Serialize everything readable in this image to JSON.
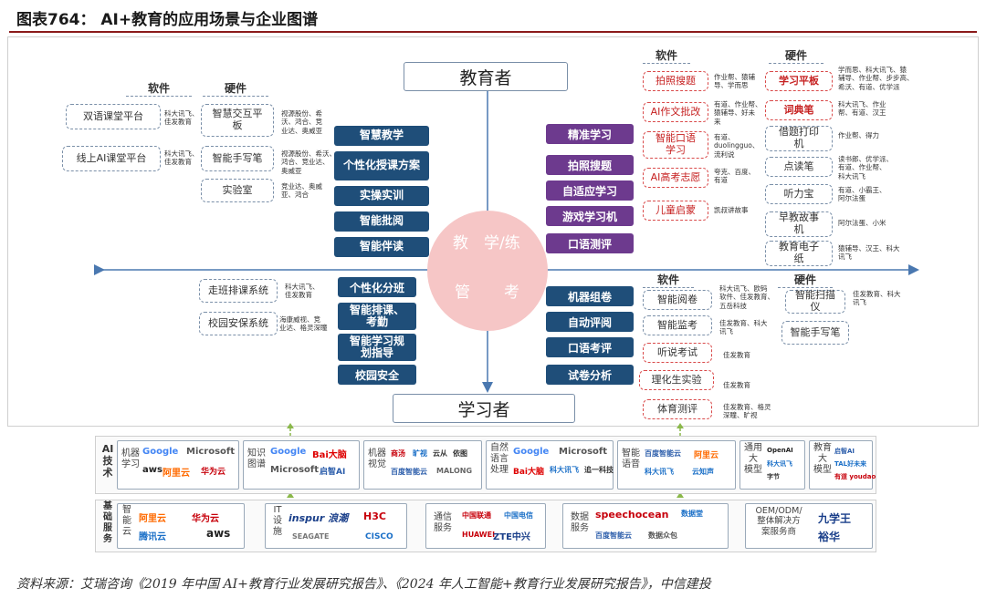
{
  "title": "图表764： AI+教育的应用场景与企业图谱",
  "source": "资料来源：艾瑞咨询《2019 年中国 AI+教育行业发展研究报告》、《2024 年人工智能+教育行业发展研究报告》，中信建投",
  "roles": {
    "educator": "教育者",
    "learner": "学习者"
  },
  "center": {
    "teach": "教",
    "learn": "学/练",
    "manage": "管",
    "test": "考"
  },
  "headers": {
    "software": "软件",
    "hardware": "硬件"
  },
  "top_left": {
    "software": [
      {
        "label": "双语课堂平台",
        "companies": "科大讯飞、\n佳发教育"
      },
      {
        "label": "线上AI课堂平台",
        "companies": "科大讯飞、\n佳发教育"
      }
    ],
    "hardware": [
      {
        "label": "智慧交互平板",
        "companies": "视源股份、希\n沃、鸿合、竞\n业达、奥威亚"
      },
      {
        "label": "智能手写笔",
        "companies": "视源股份、希沃、\n鸿合、竞业达、\n奥威亚"
      },
      {
        "label": "实验室",
        "companies": "竞业达、奥威\n亚、鸿合"
      }
    ]
  },
  "teach_items": [
    "智慧教学",
    "个性化授课方案",
    "实操实训",
    "智能批阅",
    "智能伴读"
  ],
  "learn_items": [
    "精准学习",
    "拍照搜题",
    "自适应学习",
    "游戏学习机",
    "口语测评"
  ],
  "manage_items": [
    "个性化分班",
    "智能排课、考勤",
    "智能学习规划指导",
    "校园安全"
  ],
  "test_items": [
    "机器组卷",
    "自动评阅",
    "口语考评",
    "试卷分析"
  ],
  "top_right": {
    "software": [
      {
        "label": "拍照搜题",
        "companies": "作业帮、猿辅\n导、学而思"
      },
      {
        "label": "AI作文批改",
        "companies": "有道、作业帮、\n猿辅导、好未\n来"
      },
      {
        "label": "智能口语学习",
        "companies": "有道、\nduolingguo、\n流利说"
      },
      {
        "label": "AI高考志愿",
        "companies": "夸克、百度、\n有道"
      },
      {
        "label": "儿童启蒙",
        "companies": "凯叔讲故事"
      }
    ],
    "hardware": [
      {
        "label": "学习平板",
        "companies": "学而思、科大讯飞、猿\n辅导、作业帮、步步高、\n希沃、有道、优学派"
      },
      {
        "label": "词典笔",
        "companies": "科大讯飞、作业\n帮、有道、汉王"
      },
      {
        "label": "借题打印机",
        "companies": "作业帮、得力"
      },
      {
        "label": "点读笔",
        "companies": "读书郎、优学派、\n有道、作业帮、\n科大讯飞"
      },
      {
        "label": "听力宝",
        "companies": "有道、小霸王、\n阿尔法蛋"
      },
      {
        "label": "早教故事机",
        "companies": "阿尔法蛋、小米"
      },
      {
        "label": "教育电子纸",
        "companies": "猿辅导、汉王、科大\n讯飞"
      }
    ]
  },
  "bottom_left": [
    {
      "label": "走班排课系统",
      "companies": "科大讯飞、\n佳发教育"
    },
    {
      "label": "校园安保系统",
      "companies": "海康威视、竞\n业达、格灵深瞳"
    }
  ],
  "bottom_right": {
    "software": [
      {
        "label": "智能阅卷",
        "companies": "科大讯飞、欧码\n软件、佳发教育、\n五岳科技"
      },
      {
        "label": "智能监考",
        "companies": "佳发教育、科大\n讯飞"
      },
      {
        "label": "听说考试",
        "companies": "佳发教育"
      },
      {
        "label": "理化生实验",
        "companies": "佳发教育"
      },
      {
        "label": "体育测评",
        "companies": "佳发教育、格灵\n深瞳、旷视"
      }
    ],
    "hardware": [
      {
        "label": "智能扫描仪",
        "companies": "佳发教育、科大\n讯飞"
      },
      {
        "label": "智能手写笔",
        "companies": ""
      }
    ]
  },
  "ai_tech": {
    "label": "AI\n技\n术",
    "cells": [
      {
        "name": "机器\n学习",
        "logos": [
          "Google",
          "Microsoft",
          "aws",
          "阿里云",
          "华为云"
        ]
      },
      {
        "name": "知识\n图谱",
        "logos": [
          "Google",
          "Bai大脑",
          "Microsoft",
          "启智AI"
        ]
      },
      {
        "name": "机器\n视觉",
        "logos": [
          "商汤",
          "旷视",
          "云从",
          "依图",
          "百度智能云",
          "MALONG"
        ]
      },
      {
        "name": "自然\n语言\n处理",
        "logos": [
          "Google",
          "Microsoft",
          "Bai大脑",
          "科大讯飞",
          "追一科技"
        ]
      },
      {
        "name": "智能\n语音",
        "logos": [
          "百度智能云",
          "阿里云",
          "科大讯飞",
          "云知声"
        ]
      },
      {
        "name": "通用\n大\n模型",
        "logos": [
          "OpenAI",
          "科大讯飞",
          "字节"
        ]
      },
      {
        "name": "教育\n大\n模型",
        "logos": [
          "启智AI",
          "TAL好未来",
          "有道 youdao"
        ]
      }
    ]
  },
  "infra": {
    "label": "基\n础\n服\n务",
    "cells": [
      {
        "name": "智\n能\n云",
        "logos": [
          "阿里云",
          "华为云",
          "腾讯云",
          "aws"
        ]
      },
      {
        "name": "IT\n设\n施",
        "logos": [
          "inspur 浪潮",
          "H3C",
          "SEAGATE",
          "CISCO"
        ]
      },
      {
        "name": "通信\n服务",
        "logos": [
          "中国联通",
          "中国电信",
          "HUAWEI",
          "ZTE中兴"
        ]
      },
      {
        "name": "数据\n服务",
        "logos": [
          "speechocean",
          "数据堂",
          "百度智能云",
          "数据众包"
        ]
      },
      {
        "name": "OEM/ODM/\n整体解决方\n案服务商",
        "logos": [
          "九学王",
          "裕华"
        ]
      }
    ]
  },
  "colors": {
    "navy": "#1f4e79",
    "purple": "#6d3a8e",
    "accent_red": "#c62020",
    "circle": "#f6c6c6",
    "title_rule": "#8b1a1a"
  }
}
